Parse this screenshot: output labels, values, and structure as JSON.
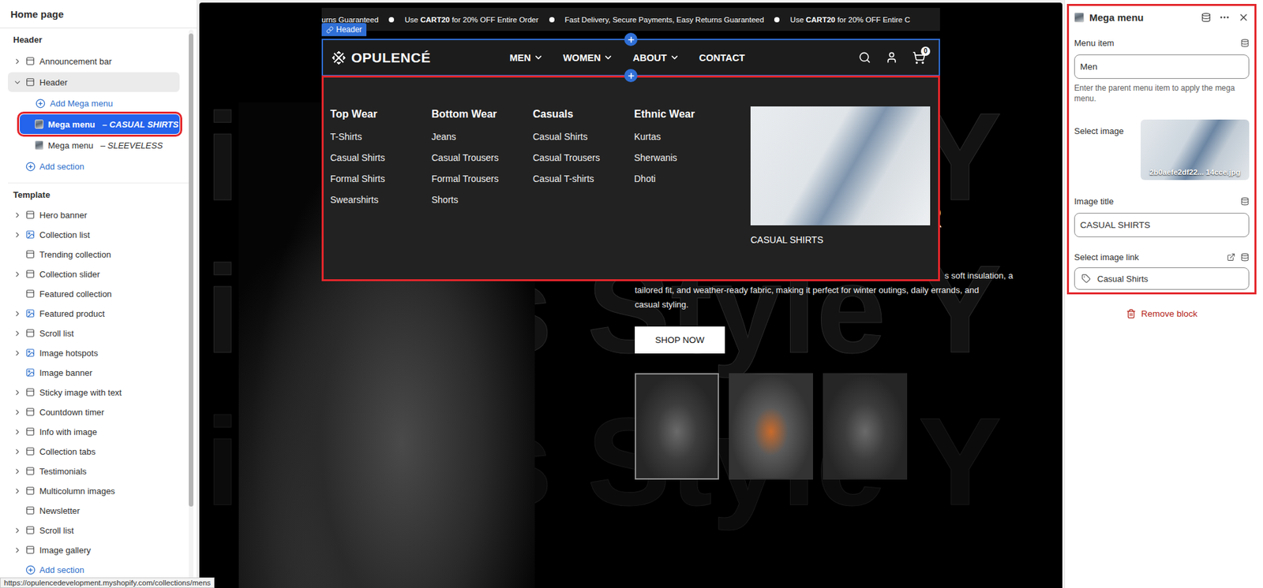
{
  "sidebar": {
    "title": "Home page",
    "groups": [
      {
        "label": "Header",
        "items": [
          {
            "kind": "section",
            "label": "Announcement bar",
            "detail": "",
            "depth": 0,
            "expandable": true,
            "expanded": false,
            "selected": false,
            "outlined": false
          },
          {
            "kind": "section",
            "label": "Header",
            "detail": "",
            "depth": 0,
            "expandable": true,
            "expanded": true,
            "selected": false,
            "outlined": false
          },
          {
            "kind": "add",
            "label": "Add Mega menu",
            "detail": "",
            "depth": 1,
            "expandable": false,
            "expanded": false,
            "selected": false,
            "outlined": false
          },
          {
            "kind": "block",
            "label": "Mega menu",
            "detail": "– CASUAL SHIRTS",
            "depth": 1,
            "expandable": false,
            "expanded": false,
            "selected": true,
            "outlined": true
          },
          {
            "kind": "block",
            "label": "Mega menu",
            "detail": "– SLEEVELESS",
            "depth": 1,
            "expandable": false,
            "expanded": false,
            "selected": false,
            "outlined": false
          },
          {
            "kind": "add",
            "label": "Add section",
            "detail": "",
            "depth": 0,
            "expandable": false,
            "expanded": false,
            "selected": false,
            "outlined": false
          }
        ]
      },
      {
        "label": "Template",
        "items": [
          {
            "kind": "section",
            "label": "Hero banner",
            "detail": "",
            "depth": 0,
            "expandable": true,
            "expanded": false,
            "selected": false,
            "outlined": false
          },
          {
            "kind": "media-section",
            "label": "Collection list",
            "detail": "",
            "depth": 0,
            "expandable": true,
            "expanded": false,
            "selected": false,
            "outlined": false
          },
          {
            "kind": "section",
            "label": "Trending collection",
            "detail": "",
            "depth": 0,
            "expandable": false,
            "expanded": false,
            "selected": false,
            "outlined": false
          },
          {
            "kind": "section",
            "label": "Collection slider",
            "detail": "",
            "depth": 0,
            "expandable": true,
            "expanded": false,
            "selected": false,
            "outlined": false
          },
          {
            "kind": "section",
            "label": "Featured collection",
            "detail": "",
            "depth": 0,
            "expandable": false,
            "expanded": false,
            "selected": false,
            "outlined": false
          },
          {
            "kind": "media-section",
            "label": "Featured product",
            "detail": "",
            "depth": 0,
            "expandable": true,
            "expanded": false,
            "selected": false,
            "outlined": false
          },
          {
            "kind": "section",
            "label": "Scroll list",
            "detail": "",
            "depth": 0,
            "expandable": true,
            "expanded": false,
            "selected": false,
            "outlined": false
          },
          {
            "kind": "media-section",
            "label": "Image hotspots",
            "detail": "",
            "depth": 0,
            "expandable": true,
            "expanded": false,
            "selected": false,
            "outlined": false
          },
          {
            "kind": "media-section",
            "label": "Image banner",
            "detail": "",
            "depth": 0,
            "expandable": false,
            "expanded": false,
            "selected": false,
            "outlined": false
          },
          {
            "kind": "section",
            "label": "Sticky image with text",
            "detail": "",
            "depth": 0,
            "expandable": true,
            "expanded": false,
            "selected": false,
            "outlined": false
          },
          {
            "kind": "section",
            "label": "Countdown timer",
            "detail": "",
            "depth": 0,
            "expandable": true,
            "expanded": false,
            "selected": false,
            "outlined": false
          },
          {
            "kind": "section",
            "label": "Info with image",
            "detail": "",
            "depth": 0,
            "expandable": true,
            "expanded": false,
            "selected": false,
            "outlined": false
          },
          {
            "kind": "section",
            "label": "Collection tabs",
            "detail": "",
            "depth": 0,
            "expandable": true,
            "expanded": false,
            "selected": false,
            "outlined": false
          },
          {
            "kind": "section",
            "label": "Testimonials",
            "detail": "",
            "depth": 0,
            "expandable": true,
            "expanded": false,
            "selected": false,
            "outlined": false
          },
          {
            "kind": "section",
            "label": "Multicolumn images",
            "detail": "",
            "depth": 0,
            "expandable": true,
            "expanded": false,
            "selected": false,
            "outlined": false
          },
          {
            "kind": "section",
            "label": "Newsletter",
            "detail": "",
            "depth": 0,
            "expandable": false,
            "expanded": false,
            "selected": false,
            "outlined": false
          },
          {
            "kind": "section",
            "label": "Scroll list",
            "detail": "",
            "depth": 0,
            "expandable": true,
            "expanded": false,
            "selected": false,
            "outlined": false
          },
          {
            "kind": "section",
            "label": "Image gallery",
            "detail": "",
            "depth": 0,
            "expandable": true,
            "expanded": false,
            "selected": false,
            "outlined": false
          },
          {
            "kind": "add",
            "label": "Add section",
            "detail": "",
            "depth": 0,
            "expandable": false,
            "expanded": false,
            "selected": false,
            "outlined": false
          }
        ]
      }
    ]
  },
  "preview": {
    "announcement": [
      {
        "segments": [
          {
            "text": "urns Guaranteed",
            "bold": false
          }
        ]
      },
      {
        "segments": [
          {
            "text": "Use ",
            "bold": false
          },
          {
            "text": "CART20",
            "bold": true
          },
          {
            "text": " for 20% OFF Entire Order",
            "bold": false
          }
        ]
      },
      {
        "segments": [
          {
            "text": "Fast Delivery, Secure Payments, Easy Returns Guaranteed",
            "bold": false
          }
        ]
      },
      {
        "segments": [
          {
            "text": "Use ",
            "bold": false
          },
          {
            "text": "CART20",
            "bold": true
          },
          {
            "text": " for 20% OFF Entire C",
            "bold": false
          }
        ]
      }
    ],
    "header": {
      "tag": "Header",
      "selected": true,
      "logo": "OPULENCÉ",
      "nav": [
        {
          "label": "MEN",
          "dropdown": true
        },
        {
          "label": "WOMEN",
          "dropdown": true
        },
        {
          "label": "ABOUT",
          "dropdown": true
        },
        {
          "label": "CONTACT",
          "dropdown": false
        }
      ],
      "cart_count": "0"
    },
    "mega_menu": {
      "outlined": true,
      "columns": [
        {
          "title": "Top Wear",
          "links": [
            "T-Shirts",
            "Casual Shirts",
            "Formal Shirts",
            "Swearshirts"
          ]
        },
        {
          "title": "Bottom Wear",
          "links": [
            "Jeans",
            "Casual Trousers",
            "Formal Trousers",
            "Shorts"
          ]
        },
        {
          "title": "Casuals",
          "links": [
            "Casual Shirts",
            "Casual Trousers",
            "Casual T-shirts"
          ]
        },
        {
          "title": "Ethnic Wear",
          "links": [
            "Kurtas",
            "Sherwanis",
            "Dhoti"
          ]
        }
      ],
      "image_caption": "CASUAL SHIRTS"
    },
    "hero": {
      "watermark": [
        "ith Us Style Y",
        "ith Us Style Y",
        "ith Us Style Y"
      ],
      "heading": "R",
      "paragraph": [
        "s soft insulation, a",
        "tailored fit, and weather-ready fabric, making it perfect for winter outings, daily errands, and",
        "casual styling."
      ],
      "button": "SHOP NOW",
      "thumbnails": [
        {
          "selected": true
        },
        {
          "selected": false
        },
        {
          "selected": false
        }
      ]
    }
  },
  "settings": {
    "title": "Mega menu",
    "outlined": true,
    "fields": [
      {
        "kind": "text",
        "label": "Menu item",
        "value": "Men",
        "help": "Enter the parent menu item to apply the mega menu.",
        "dynamic": true
      },
      {
        "kind": "image",
        "label": "Select image",
        "value": "2b0aefe2df22... 14cce.jpg",
        "help": "",
        "dynamic": false
      },
      {
        "kind": "text",
        "label": "Image title",
        "value": "CASUAL SHIRTS",
        "help": "",
        "dynamic": true
      },
      {
        "kind": "link",
        "label": "Select image link",
        "value": "Casual Shirts",
        "help": "",
        "dynamic": true
      }
    ],
    "remove": "Remove block"
  },
  "status_url": "https://opulencedevelopment.myshopify.com/collections/mens"
}
